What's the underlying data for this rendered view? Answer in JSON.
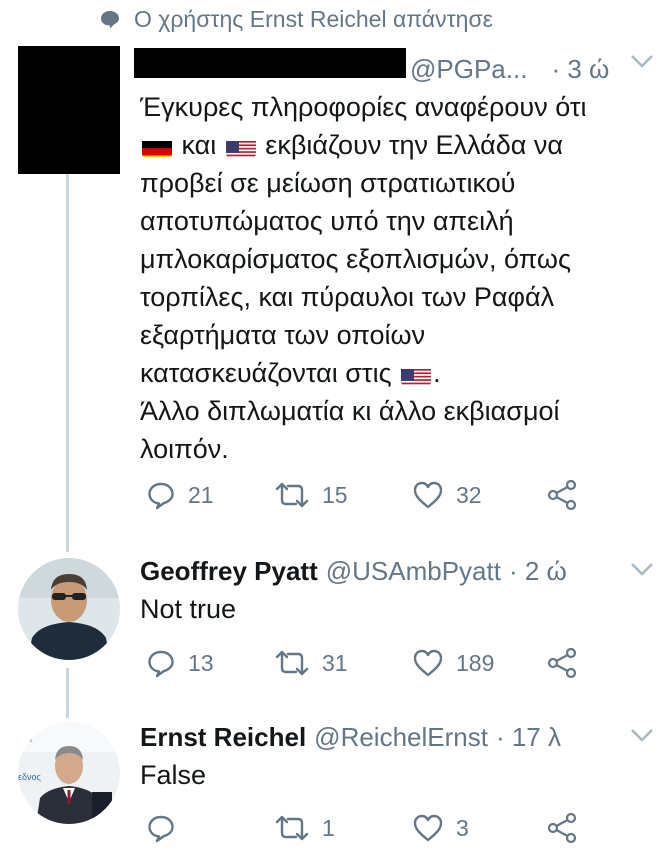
{
  "context": {
    "text": "Ο χρήστης Ernst Reichel απάντησε",
    "icon": "speech-bubble-icon"
  },
  "tweets": [
    {
      "handle": "@PGPa...",
      "time": "· 3 ώ",
      "text": {
        "line1": "Έγκυρες πληροφορίες αναφέρουν ότι",
        "flag_de": "germany-flag",
        "and": " και ",
        "flag_us": "us-flag",
        "line2_rest": " εκβιάζουν την Ελλάδα να",
        "line3": "προβεί σε μείωση στρατιωτικού",
        "line4": "αποτυπώματος υπό την απειλή",
        "line5": "μπλοκαρίσματος εξοπλισμών, όπως",
        "line6": "τορπίλες, και πύραυλοι των Ραφάλ",
        "line7": "εξαρτήματα των οποίων",
        "line8_pre": "κατασκευάζονται στις ",
        "line8_post": ".",
        "line9": "Άλλο διπλωματία κι άλλο εκβιασμοί",
        "line10": "λοιπόν."
      },
      "replies": "21",
      "retweets": "15",
      "likes": "32"
    },
    {
      "name": "Geoffrey Pyatt",
      "handle": "@USAmbPyatt",
      "time": "· 2 ώ",
      "text": "Not true",
      "replies": "13",
      "retweets": "31",
      "likes": "189"
    },
    {
      "name": "Ernst Reichel",
      "handle": "@ReichelErnst",
      "time": "· 17 λ",
      "text": "False",
      "replies": "",
      "retweets": "1",
      "likes": "3",
      "avatar_bg_text": "εδνος"
    }
  ],
  "colors": {
    "muted": "#657786",
    "text": "#14171a",
    "line": "#ccd6dd"
  }
}
